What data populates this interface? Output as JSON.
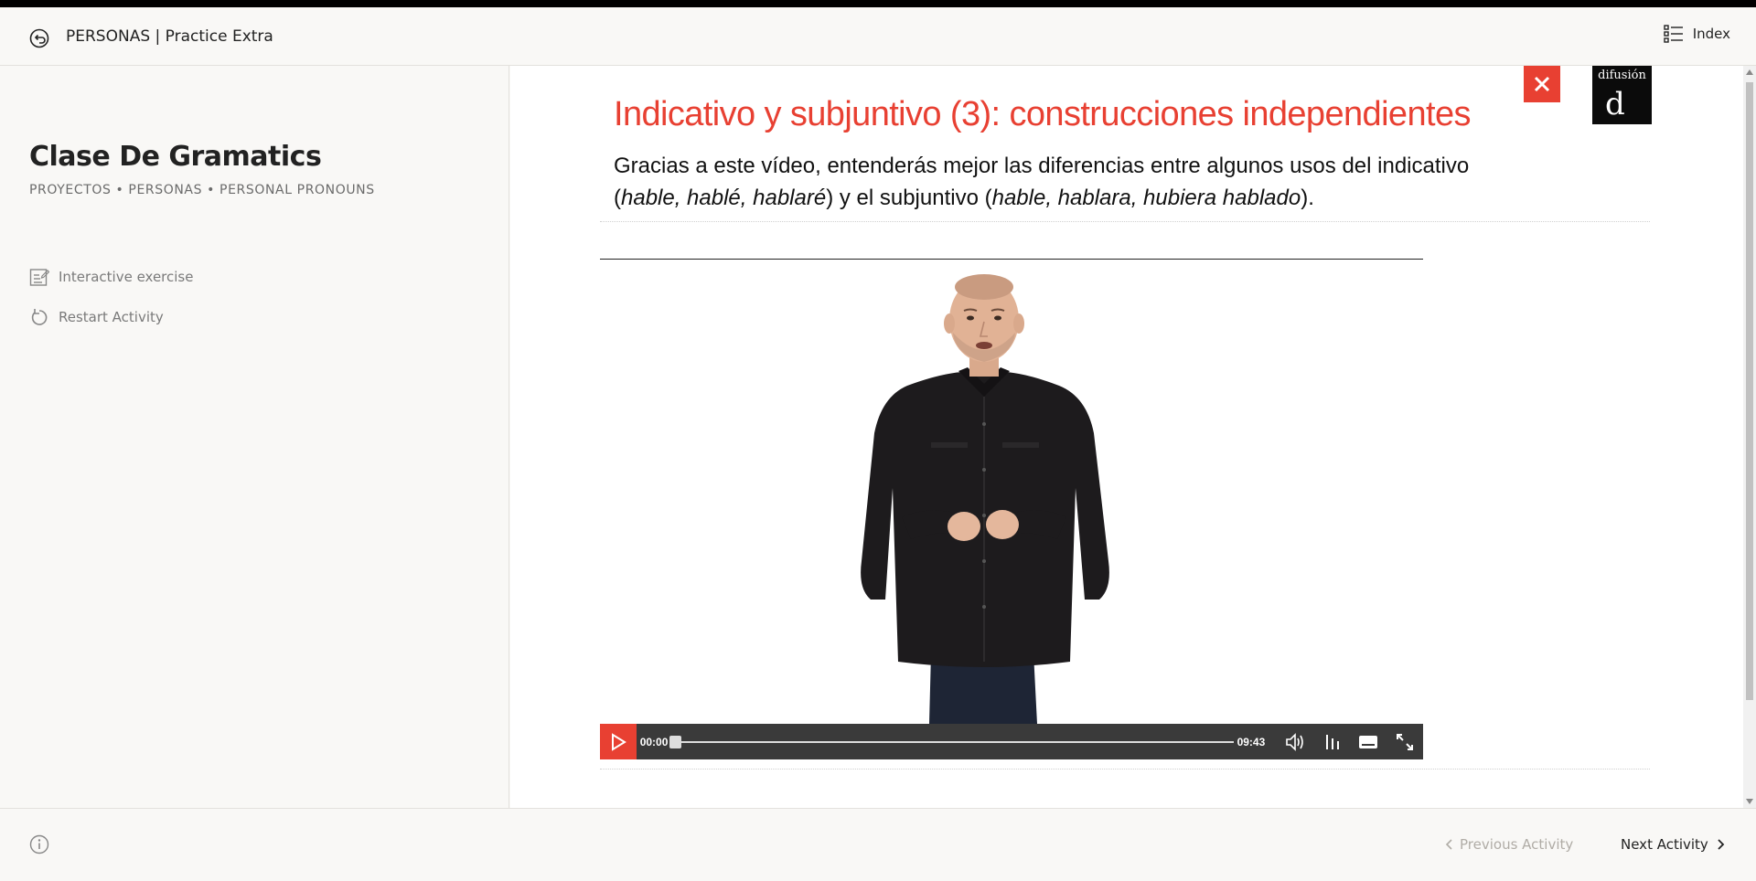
{
  "header": {
    "title": "PERSONAS | Practice Extra",
    "index_label": "Index"
  },
  "sidebar": {
    "course_title": "Clase De Gramatics",
    "breadcrumb": "PROYECTOS • PERSONAS • PERSONAL PRONOUNS",
    "items": [
      {
        "label": "Interactive exercise",
        "icon": "exercise-icon"
      },
      {
        "label": "Restart Activity",
        "icon": "restart-icon"
      }
    ]
  },
  "activity": {
    "title": "Indicativo y subjuntivo (3): construcciones independientes",
    "desc_1": "Gracias a este vídeo, entenderás mejor las diferencias entre algunos usos del indicativo (",
    "desc_2": "hable, hablé, hablaré",
    "desc_3": ") y el subjuntivo (",
    "desc_4": "hable, hablara, hubiera hablado",
    "desc_5": ")."
  },
  "logo": {
    "text": "difusión",
    "mark": "d"
  },
  "video": {
    "current_time": "00:00",
    "total_time": "09:43",
    "progress": 0
  },
  "footer": {
    "prev_label": "Previous Activity",
    "next_label": "Next Activity"
  },
  "colors": {
    "accent": "#e84032",
    "controls_bg": "#3a3a3a",
    "page_bg": "#f9f8f6"
  }
}
